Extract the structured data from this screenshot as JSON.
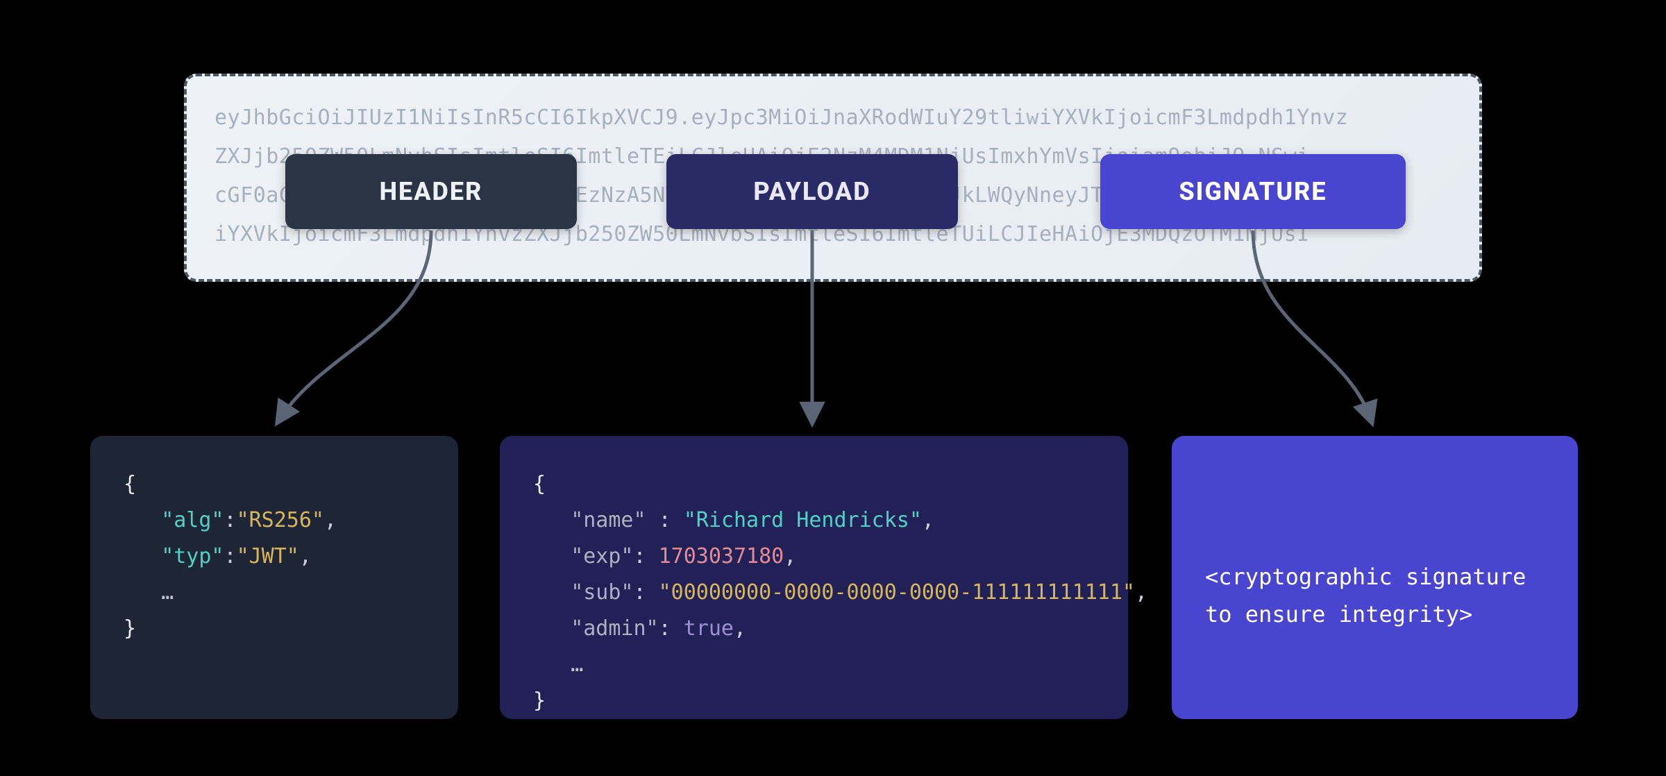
{
  "token": {
    "lines": [
      "eyJhbGciOiJIUzI1NiIsInR5cCI6IkpXVCJ9.eyJpc3MiOiJnaXRodWIuY29tliwiYXVkIjoicmF3Lmdpdh1Ynvz",
      "ZXJjb250ZW50LmNvbSIsImtleSI6ImtleTEiLCJleHAiOjE2NzM4MDM1NjUsImxhYmVsIjoiam9obiJ9.NSwi",
      "cGF0aCIsInIiLCJIUzI6MjkyMjMDEzNzA5NTUxNjE1LCJkbCI6LWQyNeyJkLWQyNneyJTGNM1NjUsE29tliw",
      "iYXVkIjoicmF3Lmdpdh1YnvzZXJjb250ZW50LmNvbSIsImtleSI6ImtleTUiLCJIeHAiOjE3MDQzOTM1NjUsI"
    ]
  },
  "labels": {
    "header": "HEADER",
    "payload": "PAYLOAD",
    "signature": "SIGNATURE"
  },
  "decoded": {
    "header": {
      "alg_key": "\"alg\"",
      "alg_val": "\"RS256\"",
      "typ_key": "\"typ\"",
      "typ_val": "\"JWT\"",
      "ellipsis": "…"
    },
    "payload": {
      "name_key": "\"name\"",
      "name_val": "\"Richard Hendricks\"",
      "exp_key": "\"exp\"",
      "exp_val": "1703037180",
      "sub_key": "\"sub\"",
      "sub_val": "\"00000000-0000-0000-0000-111111111111\"",
      "admin_key": "\"admin\"",
      "admin_val": "true",
      "ellipsis": "…"
    },
    "signature_text": "<cryptographic signature to ensure integrity>"
  }
}
